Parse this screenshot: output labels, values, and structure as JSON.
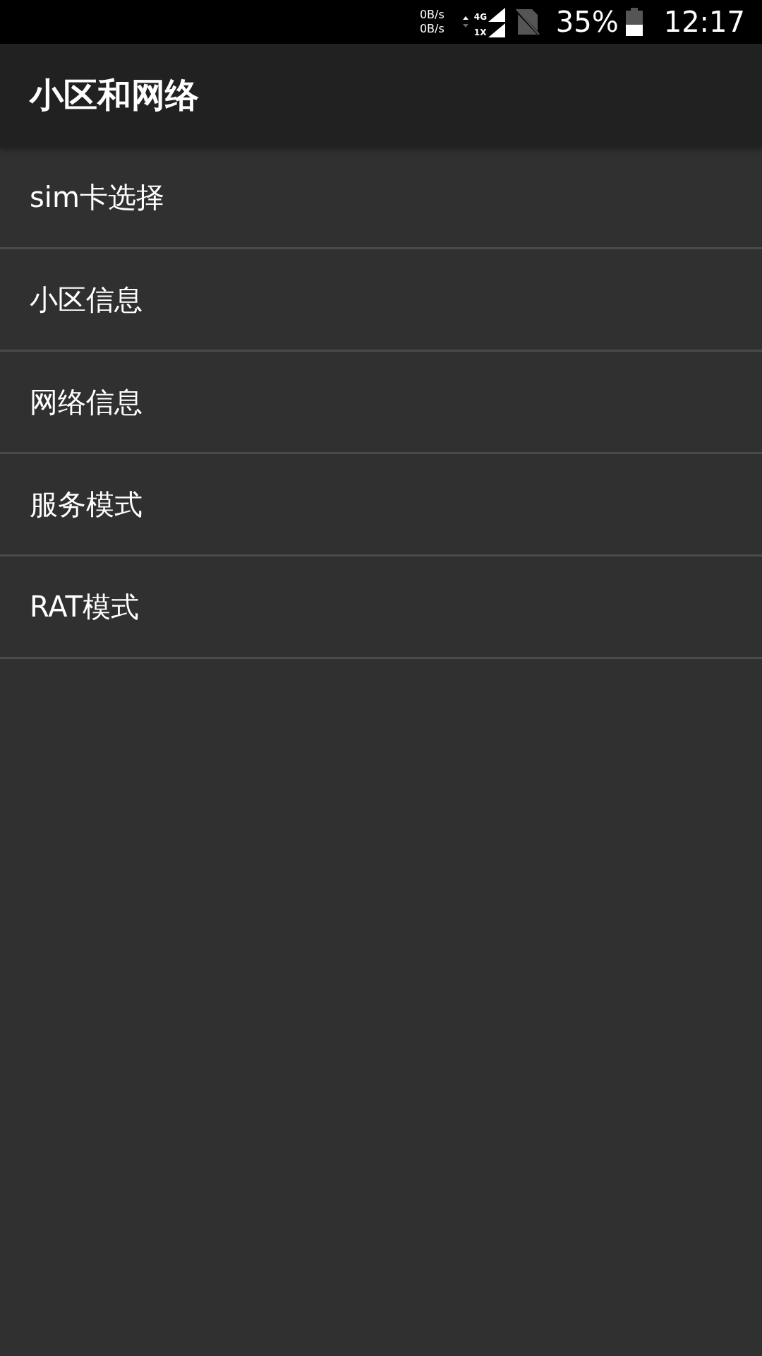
{
  "status_bar": {
    "upload_rate": "0B/s",
    "download_rate": "0B/s",
    "network_top": "4G",
    "network_bottom": "1X",
    "battery_percent": "35%",
    "time": "12:17"
  },
  "app_bar": {
    "title": "小区和网络"
  },
  "items": [
    {
      "label": "sim卡选择"
    },
    {
      "label": "小区信息"
    },
    {
      "label": "网络信息"
    },
    {
      "label": "服务模式"
    },
    {
      "label": "RAT模式"
    }
  ]
}
